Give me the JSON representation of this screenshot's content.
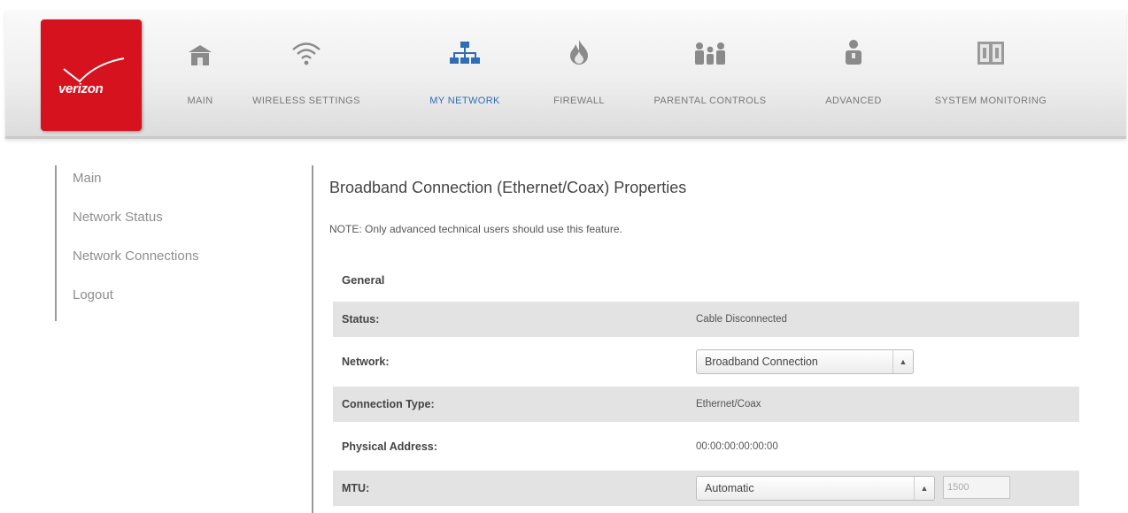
{
  "brand": {
    "logo_text": "verizon",
    "accent": "#d7121f"
  },
  "nav": {
    "active_color": "#2f6db4",
    "items": [
      {
        "label": "MAIN",
        "icon": "home-icon"
      },
      {
        "label": "WIRELESS SETTINGS",
        "icon": "wifi-icon"
      },
      {
        "label": "MY NETWORK",
        "icon": "network-icon",
        "active": true
      },
      {
        "label": "FIREWALL",
        "icon": "flame-icon"
      },
      {
        "label": "PARENTAL CONTROLS",
        "icon": "family-icon"
      },
      {
        "label": "ADVANCED",
        "icon": "person-icon"
      },
      {
        "label": "SYSTEM MONITORING",
        "icon": "monitor-icon"
      }
    ]
  },
  "sidebar": {
    "items": [
      {
        "label": "Main"
      },
      {
        "label": "Network Status"
      },
      {
        "label": "Network Connections"
      },
      {
        "label": "Logout"
      }
    ]
  },
  "main": {
    "title": "Broadband Connection (Ethernet/Coax) Properties",
    "note": "NOTE: Only advanced technical users should use this feature.",
    "section": "General",
    "rows": {
      "status": {
        "label": "Status:",
        "value": "Cable Disconnected"
      },
      "network": {
        "label": "Network:",
        "selected": "Broadband Connection"
      },
      "connection_type": {
        "label": "Connection Type:",
        "value": "Ethernet/Coax"
      },
      "physical_address": {
        "label": "Physical Address:",
        "value": "00:00:00:00:00:00"
      },
      "mtu": {
        "label": "MTU:",
        "selected": "Automatic",
        "input_value": "1500"
      }
    }
  }
}
